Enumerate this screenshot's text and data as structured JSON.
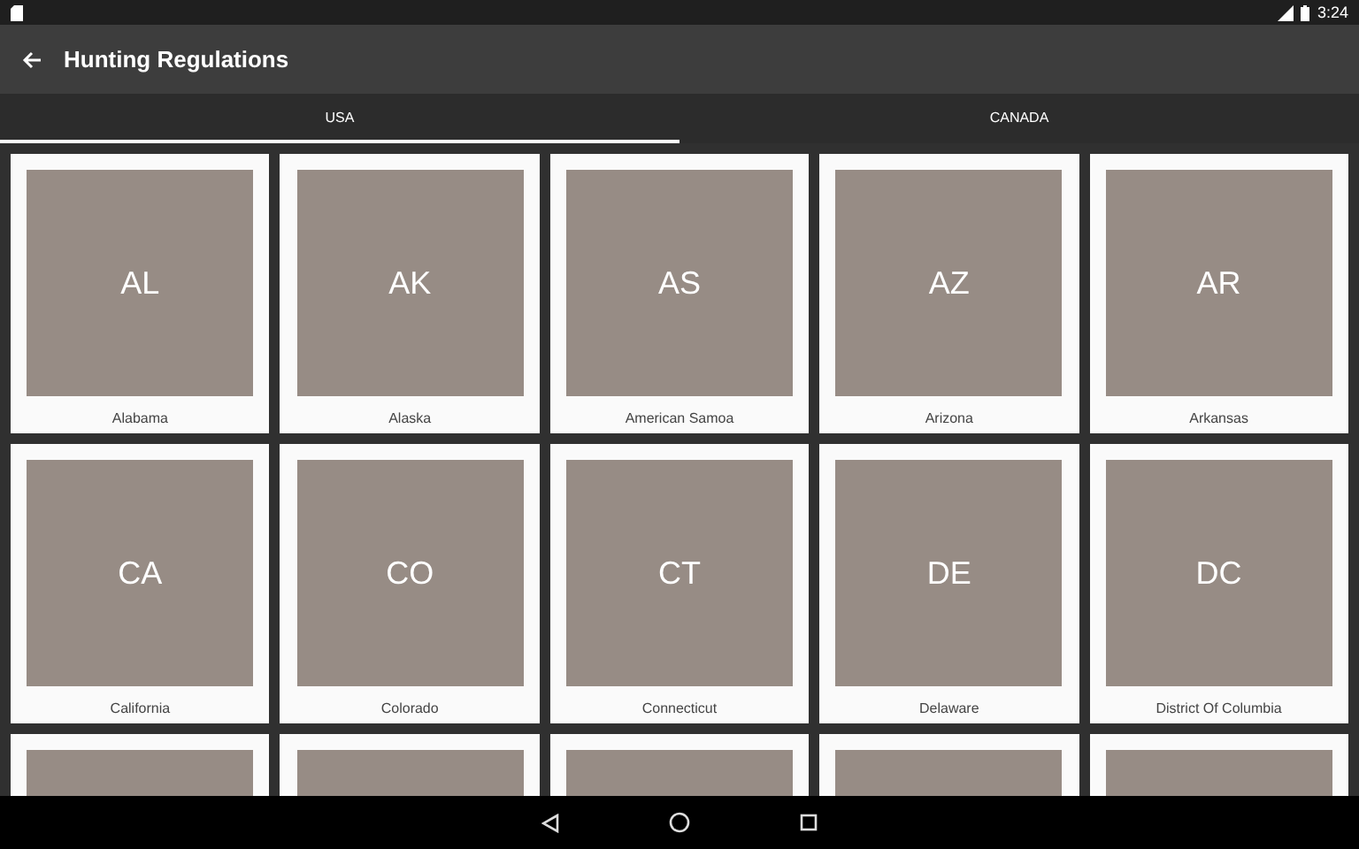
{
  "status_bar": {
    "time": "3:24"
  },
  "app_bar": {
    "title": "Hunting Regulations"
  },
  "tabs": [
    {
      "label": "USA",
      "selected": true
    },
    {
      "label": "CANADA",
      "selected": false
    }
  ],
  "grid": [
    {
      "kind": "tile",
      "code": "AL",
      "name": "Alabama"
    },
    {
      "kind": "tile",
      "code": "AK",
      "name": "Alaska"
    },
    {
      "kind": "tile",
      "code": "AS",
      "name": "American Samoa"
    },
    {
      "kind": "tile",
      "code": "AZ",
      "name": "Arizona"
    },
    {
      "kind": "tile",
      "code": "AR",
      "name": "Arkansas"
    },
    {
      "kind": "tile",
      "code": "CA",
      "name": "California"
    },
    {
      "kind": "tile",
      "code": "CO",
      "name": "Colorado"
    },
    {
      "kind": "tile",
      "code": "CT",
      "name": "Connecticut"
    },
    {
      "kind": "tile",
      "code": "DE",
      "name": "Delaware"
    },
    {
      "kind": "tile",
      "code": "DC",
      "name": "District Of Columbia"
    },
    {
      "kind": "cut"
    },
    {
      "kind": "cut"
    },
    {
      "kind": "cut"
    },
    {
      "kind": "cut"
    },
    {
      "kind": "cut"
    }
  ]
}
